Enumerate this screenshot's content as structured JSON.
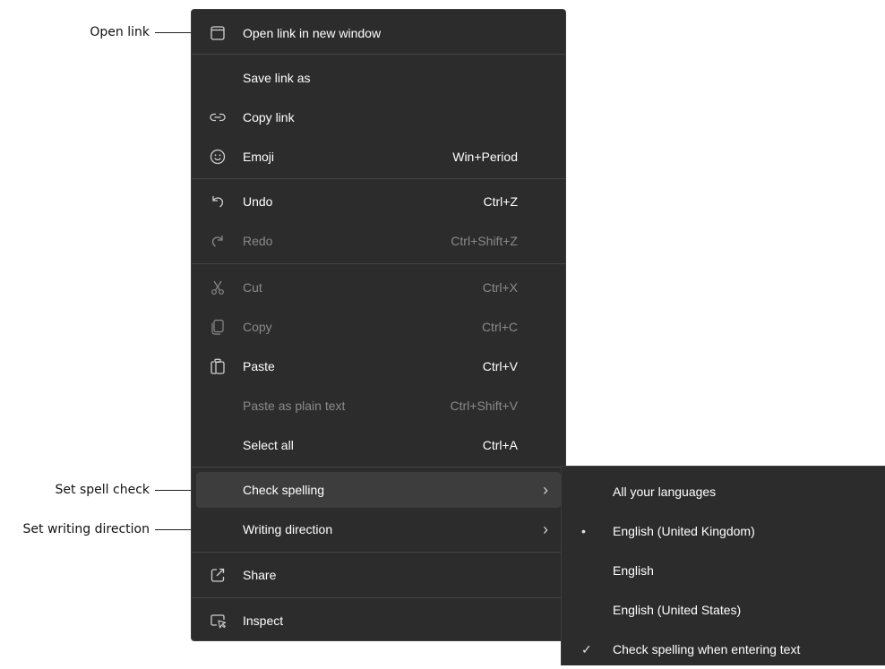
{
  "callouts": {
    "open_link": "Open link",
    "spell_check": "Set spell check",
    "writing_direction": "Set writing direction"
  },
  "menu": {
    "open_new_window": {
      "label": "Open link in new window",
      "icon": "window-icon"
    },
    "save_link_as": {
      "label": "Save link as"
    },
    "copy_link": {
      "label": "Copy link",
      "icon": "link-icon"
    },
    "emoji": {
      "label": "Emoji",
      "shortcut": "Win+Period",
      "icon": "smiley-icon"
    },
    "undo": {
      "label": "Undo",
      "shortcut": "Ctrl+Z",
      "icon": "undo-icon"
    },
    "redo": {
      "label": "Redo",
      "shortcut": "Ctrl+Shift+Z",
      "icon": "redo-icon",
      "disabled": true
    },
    "cut": {
      "label": "Cut",
      "shortcut": "Ctrl+X",
      "icon": "scissors-icon",
      "disabled": true
    },
    "copy": {
      "label": "Copy",
      "shortcut": "Ctrl+C",
      "icon": "copy-icon",
      "disabled": true
    },
    "paste": {
      "label": "Paste",
      "shortcut": "Ctrl+V",
      "icon": "clipboard-icon"
    },
    "paste_plain": {
      "label": "Paste as plain text",
      "shortcut": "Ctrl+Shift+V",
      "disabled": true
    },
    "select_all": {
      "label": "Select all",
      "shortcut": "Ctrl+A"
    },
    "check_spelling": {
      "label": "Check spelling",
      "highlighted": true
    },
    "writing_direction": {
      "label": "Writing direction"
    },
    "share": {
      "label": "Share",
      "icon": "share-icon"
    },
    "inspect": {
      "label": "Inspect",
      "icon": "inspect-icon"
    }
  },
  "submenu": {
    "items": [
      {
        "label": "All your languages",
        "mark": ""
      },
      {
        "label": "English (United Kingdom)",
        "mark": "•"
      },
      {
        "label": "English",
        "mark": ""
      },
      {
        "label": "English (United States)",
        "mark": ""
      },
      {
        "label": "Check spelling when entering text",
        "mark": "✓"
      }
    ]
  },
  "colors": {
    "menu_bg": "#2c2c2c",
    "highlight_bg": "#3d3d3d",
    "text": "#ffffff",
    "disabled_text": "#8a8a8a"
  }
}
